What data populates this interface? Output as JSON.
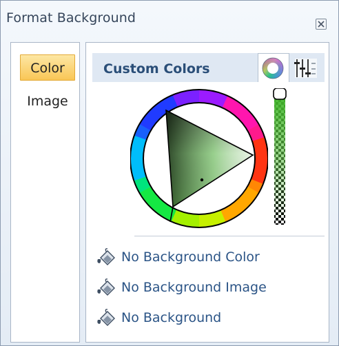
{
  "window": {
    "title": "Format Background"
  },
  "categories": [
    {
      "label": "Color",
      "active": true
    },
    {
      "label": "Image",
      "active": false
    }
  ],
  "color_panel": {
    "tab_title": "Custom Colors",
    "tabs": [
      {
        "icon": "color-wheel-icon",
        "selected": true
      },
      {
        "icon": "sliders-icon",
        "selected": false
      }
    ]
  },
  "actions": [
    {
      "label": "No Background Color",
      "icon": "paint-bucket-icon"
    },
    {
      "label": "No Background Image",
      "icon": "paint-bucket-icon"
    },
    {
      "label": "No Background",
      "icon": "paint-bucket-icon"
    }
  ],
  "colors": {
    "selected_category_bg": "#f9c656",
    "link_text": "#2b5486",
    "tab_header_text": "#2a4e78",
    "tab_bar_bg": "#dfe8f3",
    "triangle_hue": "#56c33b"
  }
}
